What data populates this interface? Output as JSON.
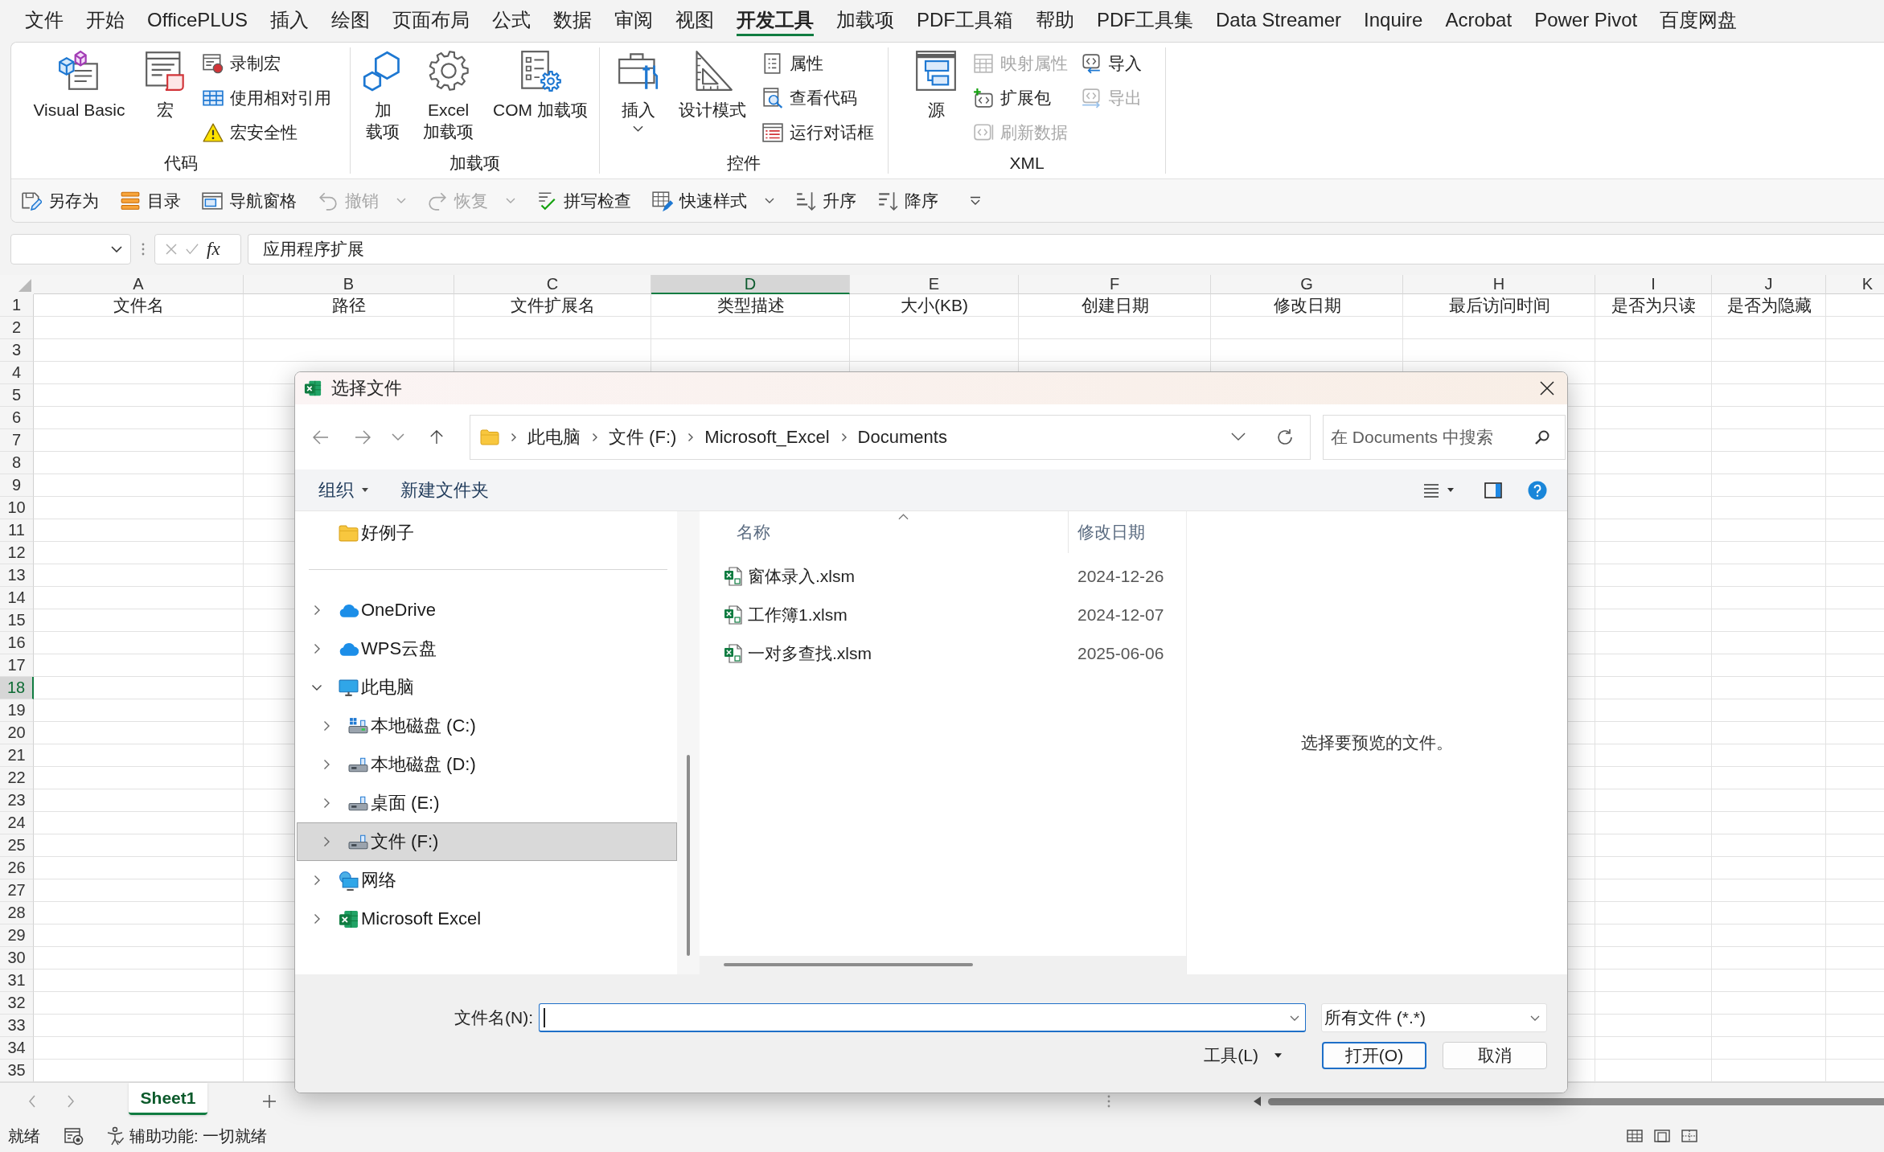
{
  "menu_tabs": [
    {
      "label": "文件",
      "selected": false
    },
    {
      "label": "开始",
      "selected": false
    },
    {
      "label": "OfficePLUS",
      "selected": false
    },
    {
      "label": "插入",
      "selected": false
    },
    {
      "label": "绘图",
      "selected": false
    },
    {
      "label": "页面布局",
      "selected": false
    },
    {
      "label": "公式",
      "selected": false
    },
    {
      "label": "数据",
      "selected": false
    },
    {
      "label": "审阅",
      "selected": false
    },
    {
      "label": "视图",
      "selected": false
    },
    {
      "label": "开发工具",
      "selected": true
    },
    {
      "label": "加载项",
      "selected": false
    },
    {
      "label": "PDF工具箱",
      "selected": false
    },
    {
      "label": "帮助",
      "selected": false
    },
    {
      "label": "PDF工具集",
      "selected": false
    },
    {
      "label": "Data Streamer",
      "selected": false
    },
    {
      "label": "Inquire",
      "selected": false
    },
    {
      "label": "Acrobat",
      "selected": false
    },
    {
      "label": "Power Pivot",
      "selected": false
    },
    {
      "label": "百度网盘",
      "selected": false
    }
  ],
  "ribbon": {
    "groups": [
      {
        "label": "代码",
        "items": [
          {
            "kind": "large",
            "lines": [
              "Visual Basic"
            ],
            "dropdown": false
          },
          {
            "kind": "large",
            "lines": [
              "宏"
            ],
            "dropdown": false
          },
          {
            "kind": "stack",
            "items": [
              {
                "label": "录制宏",
                "disabled": false
              },
              {
                "label": "使用相对引用",
                "disabled": false
              },
              {
                "label": "宏安全性",
                "disabled": false
              }
            ]
          }
        ]
      },
      {
        "label": "加载项",
        "items": [
          {
            "kind": "large",
            "lines": [
              "加",
              "载项"
            ],
            "dropdown": false
          },
          {
            "kind": "large",
            "lines": [
              "Excel",
              "加载项"
            ],
            "dropdown": false
          },
          {
            "kind": "large",
            "lines": [
              "COM 加载项"
            ],
            "dropdown": false
          }
        ]
      },
      {
        "label": "控件",
        "items": [
          {
            "kind": "large",
            "lines": [
              "插入"
            ],
            "dropdown": true
          },
          {
            "kind": "large",
            "lines": [
              "设计模式"
            ],
            "dropdown": false
          },
          {
            "kind": "stack",
            "items": [
              {
                "label": "属性",
                "disabled": false
              },
              {
                "label": "查看代码",
                "disabled": false
              },
              {
                "label": "运行对话框",
                "disabled": false
              }
            ]
          }
        ]
      },
      {
        "label": "XML",
        "items": [
          {
            "kind": "large",
            "lines": [
              "源"
            ],
            "dropdown": false
          },
          {
            "kind": "stack",
            "items": [
              {
                "label": "映射属性",
                "disabled": true
              },
              {
                "label": "扩展包",
                "disabled": false
              },
              {
                "label": "刷新数据",
                "disabled": true
              }
            ]
          },
          {
            "kind": "stack",
            "items": [
              {
                "label": "导入",
                "disabled": false
              },
              {
                "label": "导出",
                "disabled": true
              }
            ]
          }
        ]
      }
    ]
  },
  "quick_access": [
    {
      "label": "另存为",
      "disabled": false,
      "dropdown": false
    },
    {
      "label": "目录",
      "disabled": false,
      "dropdown": false
    },
    {
      "label": "导航窗格",
      "disabled": false,
      "dropdown": false
    },
    {
      "label": "撤销",
      "disabled": true,
      "dropdown": true
    },
    {
      "label": "恢复",
      "disabled": true,
      "dropdown": true
    },
    {
      "label": "拼写检查",
      "disabled": false,
      "dropdown": false
    },
    {
      "label": "快速样式",
      "disabled": false,
      "dropdown": true
    },
    {
      "label": "升序",
      "disabled": false,
      "dropdown": false
    },
    {
      "label": "降序",
      "disabled": false,
      "dropdown": false
    }
  ],
  "formula_bar": {
    "function_label": "fx",
    "formula": "应用程序扩展"
  },
  "sheet": {
    "columns": [
      {
        "label": "A",
        "selected": false
      },
      {
        "label": "B",
        "selected": false
      },
      {
        "label": "C",
        "selected": false
      },
      {
        "label": "D",
        "selected": true
      },
      {
        "label": "E",
        "selected": false
      },
      {
        "label": "F",
        "selected": false
      },
      {
        "label": "G",
        "selected": false
      },
      {
        "label": "H",
        "selected": false
      },
      {
        "label": "I",
        "selected": false
      },
      {
        "label": "J",
        "selected": false
      },
      {
        "label": "K",
        "selected": false
      }
    ],
    "rows": [
      {
        "label": "1",
        "selected": false
      },
      {
        "label": "2",
        "selected": false
      },
      {
        "label": "3",
        "selected": false
      },
      {
        "label": "4",
        "selected": false
      },
      {
        "label": "5",
        "selected": false
      },
      {
        "label": "6",
        "selected": false
      },
      {
        "label": "7",
        "selected": false
      },
      {
        "label": "8",
        "selected": false
      },
      {
        "label": "9",
        "selected": false
      },
      {
        "label": "10",
        "selected": false
      },
      {
        "label": "11",
        "selected": false
      },
      {
        "label": "12",
        "selected": false
      },
      {
        "label": "13",
        "selected": false
      },
      {
        "label": "14",
        "selected": false
      },
      {
        "label": "15",
        "selected": false
      },
      {
        "label": "16",
        "selected": false
      },
      {
        "label": "17",
        "selected": false
      },
      {
        "label": "18",
        "selected": true
      },
      {
        "label": "19",
        "selected": false
      },
      {
        "label": "20",
        "selected": false
      },
      {
        "label": "21",
        "selected": false
      },
      {
        "label": "22",
        "selected": false
      },
      {
        "label": "23",
        "selected": false
      },
      {
        "label": "24",
        "selected": false
      },
      {
        "label": "25",
        "selected": false
      },
      {
        "label": "26",
        "selected": false
      },
      {
        "label": "27",
        "selected": false
      },
      {
        "label": "28",
        "selected": false
      },
      {
        "label": "29",
        "selected": false
      },
      {
        "label": "30",
        "selected": false
      },
      {
        "label": "31",
        "selected": false
      },
      {
        "label": "32",
        "selected": false
      },
      {
        "label": "33",
        "selected": false
      },
      {
        "label": "34",
        "selected": false
      },
      {
        "label": "35",
        "selected": false
      }
    ],
    "row_1": [
      "文件名",
      "路径",
      "文件扩展名",
      "类型描述",
      "大小(KB)",
      "创建日期",
      "修改日期",
      "最后访问时间",
      "是否为只读",
      "是否为隐藏"
    ],
    "tabs": [
      {
        "label": "Sheet1",
        "selected": true
      }
    ]
  },
  "status_bar": {
    "ready": "就绪",
    "accessibility": "辅助功能: 一切就绪"
  },
  "dialog": {
    "title": "选择文件",
    "breadcrumb": [
      "此电脑",
      "文件 (F:)",
      "Microsoft_Excel",
      "Documents"
    ],
    "search": {
      "placeholder": "在 Documents 中搜索"
    },
    "commands": [
      {
        "label": "组织",
        "dropdown": true
      },
      {
        "label": "新建文件夹",
        "dropdown": false
      }
    ],
    "nav": {
      "pinned": [
        {
          "label": "好例子",
          "kind": "folder",
          "selected": false
        }
      ],
      "tree": [
        {
          "label": "OneDrive",
          "kind": "cloud",
          "expanded": false,
          "selected": false
        },
        {
          "label": "WPS云盘",
          "kind": "cloud",
          "expanded": false,
          "selected": false
        },
        {
          "label": "此电脑",
          "kind": "computer",
          "expanded": true,
          "selected": false,
          "children": [
            {
              "label": "本地磁盘 (C:)",
              "kind": "system-drive",
              "expanded": false,
              "selected": false
            },
            {
              "label": "本地磁盘 (D:)",
              "kind": "drive",
              "expanded": false,
              "selected": false
            },
            {
              "label": "桌面 (E:)",
              "kind": "drive",
              "expanded": false,
              "selected": false
            },
            {
              "label": "文件 (F:)",
              "kind": "drive",
              "expanded": false,
              "selected": true
            }
          ]
        },
        {
          "label": "网络",
          "kind": "network",
          "expanded": false,
          "selected": false
        },
        {
          "label": "Microsoft Excel",
          "kind": "app",
          "expanded": false,
          "selected": false
        }
      ]
    },
    "file_list": {
      "columns": [
        {
          "label": "名称",
          "sorted": true
        },
        {
          "label": "修改日期",
          "sorted": false
        }
      ],
      "rows": [
        {
          "name": "窗体录入.xlsm",
          "modified": "2024-12-26",
          "selected": false
        },
        {
          "name": "工作簿1.xlsm",
          "modified": "2024-12-07",
          "selected": false
        },
        {
          "name": "一对多查找.xlsm",
          "modified": "2025-06-06",
          "selected": false
        }
      ]
    },
    "preview": {
      "message": "选择要预览的文件。"
    },
    "file_name": {
      "label": "文件名(N):"
    },
    "file_type": {
      "value": "所有文件 (*.*)"
    },
    "tools": {
      "label": "工具(L)"
    },
    "buttons": [
      {
        "label": "打开(O)",
        "default": true
      },
      {
        "label": "取消",
        "default": false
      }
    ]
  }
}
